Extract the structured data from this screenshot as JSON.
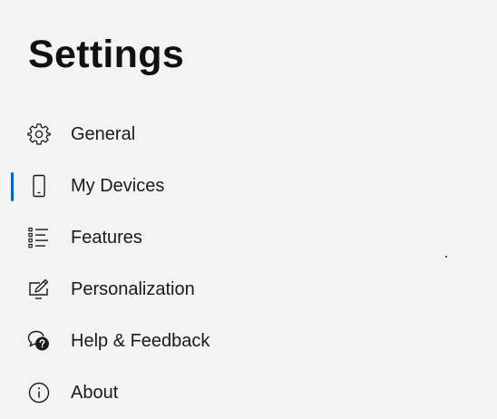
{
  "page": {
    "title": "Settings"
  },
  "nav": {
    "items": [
      {
        "label": "General",
        "icon": "gear-icon",
        "selected": false
      },
      {
        "label": "My Devices",
        "icon": "phone-icon",
        "selected": true
      },
      {
        "label": "Features",
        "icon": "list-icon",
        "selected": false
      },
      {
        "label": "Personalization",
        "icon": "pen-monitor-icon",
        "selected": false
      },
      {
        "label": "Help & Feedback",
        "icon": "help-chat-icon",
        "selected": false
      },
      {
        "label": "About",
        "icon": "info-icon",
        "selected": false
      }
    ],
    "accent_color": "#0067c0"
  }
}
